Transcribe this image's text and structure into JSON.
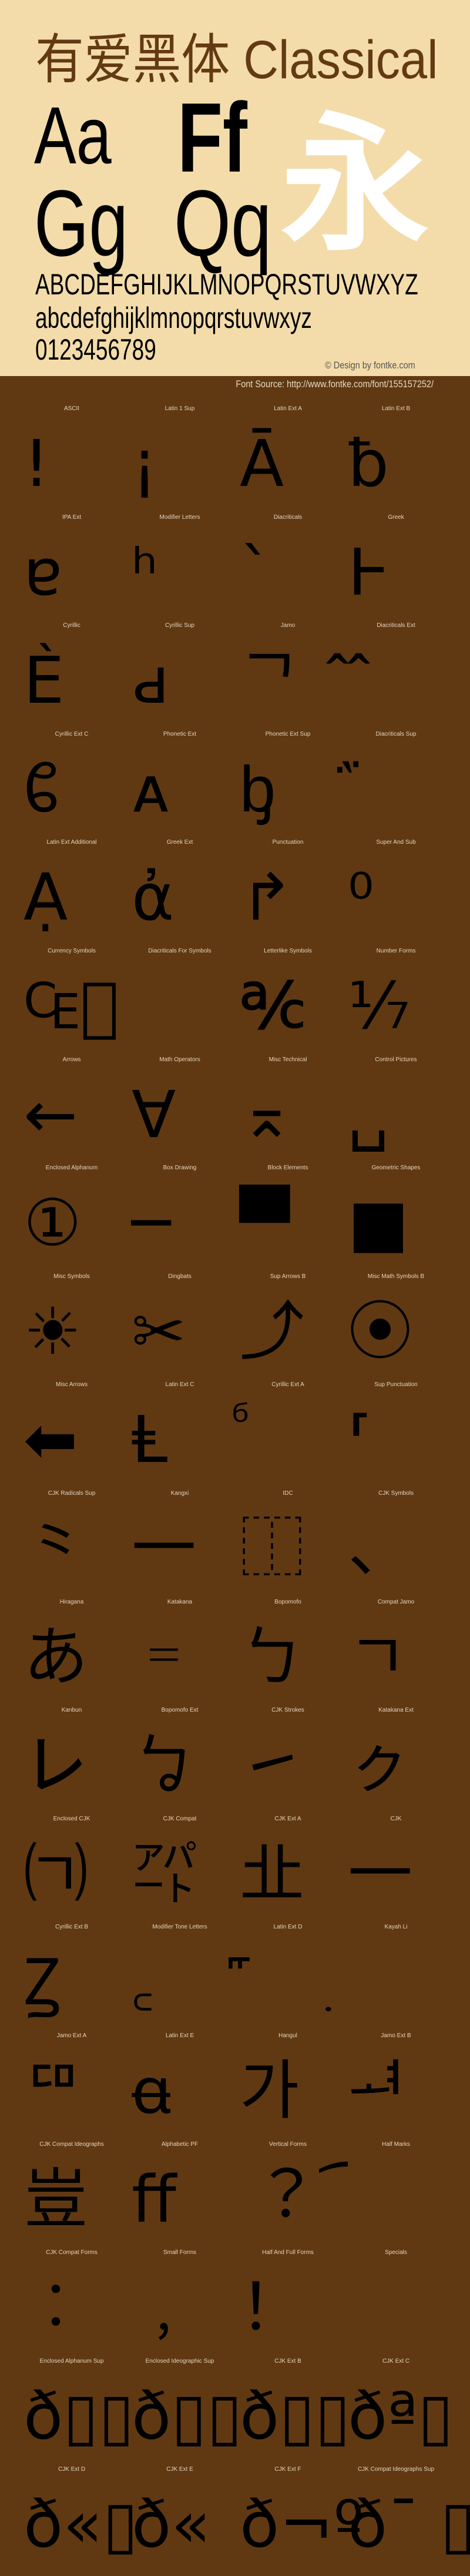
{
  "header": {
    "title": "有爱黑体 Classical",
    "sample_aa": "Aa",
    "sample_ff": "Ff",
    "sample_gg": "Gg",
    "sample_qq": "Qq",
    "sample_cjk": "永",
    "uppercase": "ABCDEFGHIJKLMNOPQRSTUVWXYZ",
    "lowercase": "abcdefghijklmnopqrstuvwxyz",
    "digits": "0123456789",
    "copyright": "© Design by fontke.com"
  },
  "source": "Font Source: http://www.fontke.com/font/155157252/",
  "colors": {
    "top_background": "#f3dcaa",
    "bottom_background": "#603913",
    "title": "#633a14",
    "accent_glyph": "#ffffff"
  },
  "blocks": [
    {
      "label": "ASCII",
      "glyph": "!"
    },
    {
      "label": "Latin 1 Sup",
      "glyph": "¡"
    },
    {
      "label": "Latin Ext A",
      "glyph": "Ā"
    },
    {
      "label": "Latin Ext B",
      "glyph": "ƀ"
    },
    {
      "label": "IPA Ext",
      "glyph": "ɐ"
    },
    {
      "label": "Modifier Letters",
      "glyph": "ʰ"
    },
    {
      "label": "Diacriticals",
      "glyph": "`"
    },
    {
      "label": "Greek",
      "glyph": "Ͱ"
    },
    {
      "label": "Cyrillic",
      "glyph": "Ѐ"
    },
    {
      "label": "Cyrillic Sup",
      "glyph": "ԁ"
    },
    {
      "label": "Jamo",
      "glyph": "ᄀ"
    },
    {
      "label": "Diacriticals Ext",
      "glyph": "᪰"
    },
    {
      "label": "Cyrillic Ext C",
      "glyph": "ᲀ"
    },
    {
      "label": "Phonetic Ext",
      "glyph": "ᴀ"
    },
    {
      "label": "Phonetic Ext Sup",
      "glyph": "ᶀ"
    },
    {
      "label": "Diacriticals Sup",
      "glyph": "᷀"
    },
    {
      "label": "Latin Ext Additional",
      "glyph": "Ạ"
    },
    {
      "label": "Greek Ext",
      "glyph": "ἀ"
    },
    {
      "label": "Punctuation",
      "glyph": "↱"
    },
    {
      "label": "Super And Sub",
      "glyph": "⁰"
    },
    {
      "label": "Currency Symbols",
      "glyph": "₠⃝"
    },
    {
      "label": "Diacriticals For Symbols",
      "glyph": ""
    },
    {
      "label": "Letterlike Symbols",
      "glyph": "℀"
    },
    {
      "label": "Number Forms",
      "glyph": "⅐"
    },
    {
      "label": "Arrows",
      "glyph": "←"
    },
    {
      "label": "Math Operators",
      "glyph": "∀"
    },
    {
      "label": "Misc Technical",
      "glyph": "⌅"
    },
    {
      "label": "Control Pictures",
      "glyph": "␣"
    },
    {
      "label": "Enclosed Alphanum",
      "glyph": "①"
    },
    {
      "label": "Box Drawing",
      "glyph": "─"
    },
    {
      "label": "Block Elements",
      "glyph": "▀"
    },
    {
      "label": "Geometric Shapes",
      "glyph": "■"
    },
    {
      "label": "Misc Symbols",
      "glyph": "☀"
    },
    {
      "label": "Dingbats",
      "glyph": "✂"
    },
    {
      "label": "Sup Arrows B",
      "glyph": "⤴"
    },
    {
      "label": "Misc Math Symbols B",
      "glyph": "⦿"
    },
    {
      "label": "Misc Arrows",
      "glyph": "⬅"
    },
    {
      "label": "Latin Ext C",
      "glyph": "Ⱡ"
    },
    {
      "label": "Cyrillic Ext A",
      "glyph": "ⷠ"
    },
    {
      "label": "Sup Punctuation",
      "glyph": "⸢"
    },
    {
      "label": "CJK Radicals Sup",
      "glyph": "⺀"
    },
    {
      "label": "Kangxi",
      "glyph": "⼀"
    },
    {
      "label": "IDC",
      "glyph": "⿰"
    },
    {
      "label": "CJK Symbols",
      "glyph": "、"
    },
    {
      "label": "Hiragana",
      "glyph": "あ"
    },
    {
      "label": "Katakana",
      "glyph": "゠"
    },
    {
      "label": "Bopomofo",
      "glyph": "ㄅ"
    },
    {
      "label": "Compat Jamo",
      "glyph": "ㄱ"
    },
    {
      "label": "Kanbun",
      "glyph": "㆑"
    },
    {
      "label": "Bopomofo Ext",
      "glyph": "ㆠ"
    },
    {
      "label": "CJK Strokes",
      "glyph": "㇀"
    },
    {
      "label": "Katakana Ext",
      "glyph": "ㇰ"
    },
    {
      "label": "Enclosed CJK",
      "glyph": "㈀"
    },
    {
      "label": "CJK Compat",
      "glyph": "㌀"
    },
    {
      "label": "CJK Ext A",
      "glyph": "㐀"
    },
    {
      "label": "CJK",
      "glyph": "一"
    },
    {
      "label": "Cyrillic Ext B",
      "glyph": "Ꙁ"
    },
    {
      "label": "Modifier Tone Letters",
      "glyph": "꜀"
    },
    {
      "label": "Latin Ext D",
      "glyph": "꜠"
    },
    {
      "label": "Kayah Li",
      "glyph": "꤫"
    },
    {
      "label": "Jamo Ext A",
      "glyph": "ꥠ"
    },
    {
      "label": "Latin Ext E",
      "glyph": "ꬰ"
    },
    {
      "label": "Hangul",
      "glyph": "가"
    },
    {
      "label": "Jamo Ext B",
      "glyph": "ힰ"
    },
    {
      "label": "CJK Compat Ideographs",
      "glyph": "豈"
    },
    {
      "label": "Alphabetic PF",
      "glyph": "ﬀ"
    },
    {
      "label": "Vertical Forms",
      "glyph": "︖"
    },
    {
      "label": "Half Marks",
      "glyph": "︠"
    },
    {
      "label": "CJK Compat Forms",
      "glyph": "︰"
    },
    {
      "label": "Small Forms",
      "glyph": "﹐"
    },
    {
      "label": "Half And Full Forms",
      "glyph": "！"
    },
    {
      "label": "Specials",
      "glyph": "￼"
    },
    {
      "label": "Enclosed Alphanum Sup",
      "glyph": "ð▯▯"
    },
    {
      "label": "Enclosed Ideographic Sup",
      "glyph": "ð▯▯"
    },
    {
      "label": "CJK Ext B",
      "glyph": "ð▯▯"
    },
    {
      "label": "CJK Ext C",
      "glyph": "ðª▯"
    },
    {
      "label": "CJK Ext D",
      "glyph": "ð«▯"
    },
    {
      "label": "CJK Ext E",
      "glyph": "ð«"
    },
    {
      "label": "CJK Ext F",
      "glyph": "ð¬º"
    },
    {
      "label": "CJK Compat Ideographs Sup",
      "glyph": "ð¯ ▯"
    }
  ]
}
